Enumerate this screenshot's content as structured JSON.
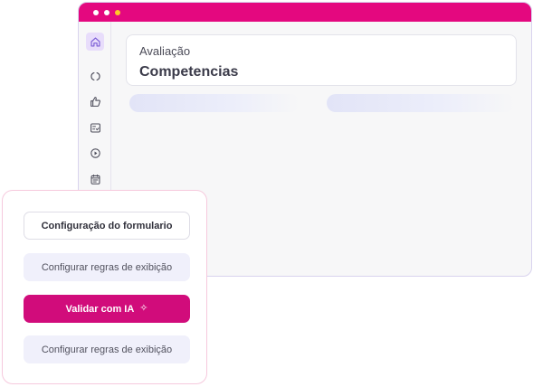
{
  "window": {
    "titlebar_color": "#e4087f",
    "dots": [
      "white",
      "white",
      "yellow"
    ]
  },
  "sidebar": {
    "items": [
      {
        "icon": "home-icon",
        "active": true
      },
      {
        "icon": "loop-icon",
        "active": false
      },
      {
        "icon": "thumbs-up-icon",
        "active": false
      },
      {
        "icon": "checklist-icon",
        "active": false
      },
      {
        "icon": "play-circle-icon",
        "active": false
      },
      {
        "icon": "calendar-icon",
        "active": false
      }
    ]
  },
  "header": {
    "subtitle": "Avaliação",
    "title": "Competencias"
  },
  "panel": {
    "form_config_label": "Configuração do formulario",
    "display_rules_label_1": "Configurar regras de exibição",
    "validate_label": "Validar com IA",
    "validate_icon": "sparkle-icon",
    "display_rules_label_2": "Configurar regras de exibição",
    "accent_color": "#d10c7b"
  }
}
